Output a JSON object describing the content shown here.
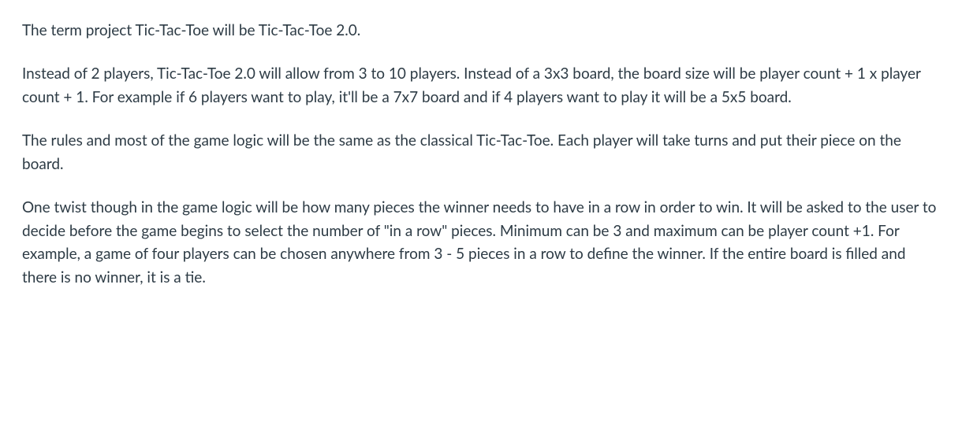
{
  "document": {
    "paragraphs": [
      "The term project Tic-Tac-Toe will be Tic-Tac-Toe 2.0.",
      "Instead of 2 players, Tic-Tac-Toe 2.0 will allow from 3 to 10 players. Instead of a 3x3 board, the board size will be player count + 1 x player count + 1. For example if 6 players want to play, it'll be a 7x7 board and if 4 players want to play it will be a 5x5 board.",
      "The rules and most of the game logic will be the same as the classical Tic-Tac-Toe. Each player will take turns and put their piece on the board.",
      "One twist though in the game logic will be how many pieces the winner needs to have in a row in order to win. It will be asked to the user to decide before the game begins to select the number of \"in a row\" pieces. Minimum can be 3 and maximum can be player count +1. For example, a game of four players can be chosen anywhere from 3 - 5 pieces in a row to define the winner. If the entire board is filled and there is no winner, it is a tie."
    ]
  }
}
